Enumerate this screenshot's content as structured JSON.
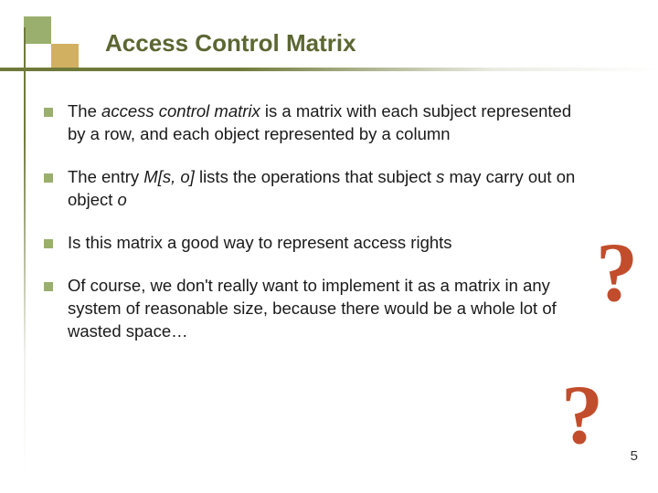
{
  "slide": {
    "title": "Access Control Matrix",
    "bullets": [
      {
        "prefix": "The ",
        "em": "access control matrix",
        "rest": " is a matrix with each subject represented by a row, and each object represented by a column"
      },
      {
        "prefix": "The entry ",
        "em": "M[s, o]",
        "mid": " lists the operations that subject ",
        "em2": "s",
        "mid2": " may carry out on object ",
        "em3": "o",
        "rest": ""
      },
      {
        "prefix": "Is this matrix a good way to represent access rights",
        "em": "",
        "rest": ""
      },
      {
        "prefix": "Of course, we don't really want to implement it as a matrix in any system of reasonable size, because there would be a whole lot of wasted space…",
        "em": "",
        "rest": ""
      }
    ],
    "question_mark": "?",
    "page_number": "5"
  }
}
